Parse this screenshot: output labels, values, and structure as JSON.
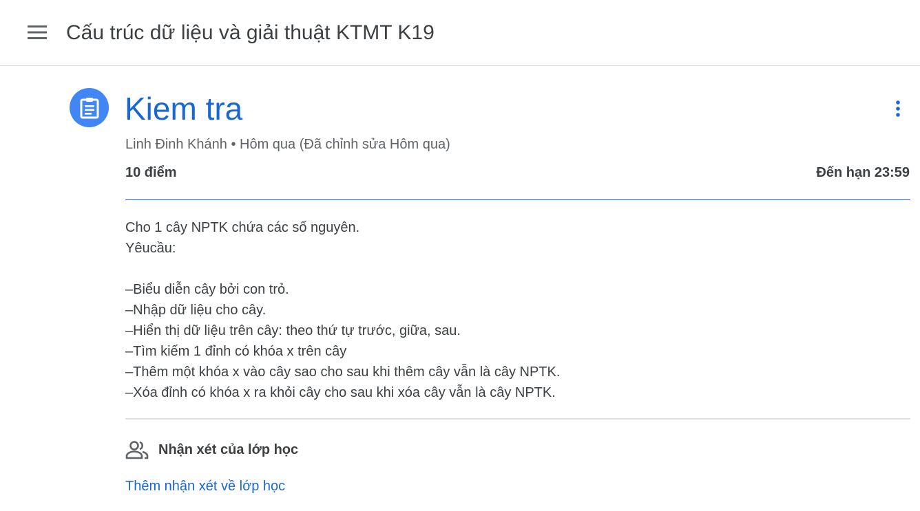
{
  "header": {
    "menu_icon": "hamburger-menu-icon",
    "class_title": "Cấu trúc dữ liệu và giải thuật KTMT K19"
  },
  "assignment": {
    "icon": "assignment-clipboard-icon",
    "title": "Kiem tra",
    "meta": "Linh Đinh Khánh • Hôm qua (Đã chỉnh sửa Hôm qua)",
    "points": "10 điểm",
    "due": "Đến hạn 23:59",
    "more_icon": "more-vert-icon",
    "description_lines": [
      "Cho 1 cây NPTK chứa các số nguyên.",
      "Yêucầu:",
      "",
      "–Biểu diễn cây bởi con trỏ.",
      "–Nhập dữ liệu cho cây.",
      "–Hiển thị dữ liệu trên cây: theo thứ tự trước, giữa, sau.",
      "–Tìm kiếm 1 đỉnh có khóa x trên cây",
      "–Thêm một khóa x vào cây sao cho sau khi thêm cây vẫn là cây NPTK.",
      "–Xóa đỉnh có khóa x ra khỏi cây cho sau khi xóa cây vẫn là cây NPTK."
    ]
  },
  "comments": {
    "icon": "people-icon",
    "title": "Nhận xét của lớp học",
    "add_label": "Thêm nhận xét về lớp học"
  },
  "colors": {
    "accent": "#1967d2",
    "icon_bg": "#4285f4",
    "text": "#3c4043",
    "muted": "#5f6368"
  }
}
